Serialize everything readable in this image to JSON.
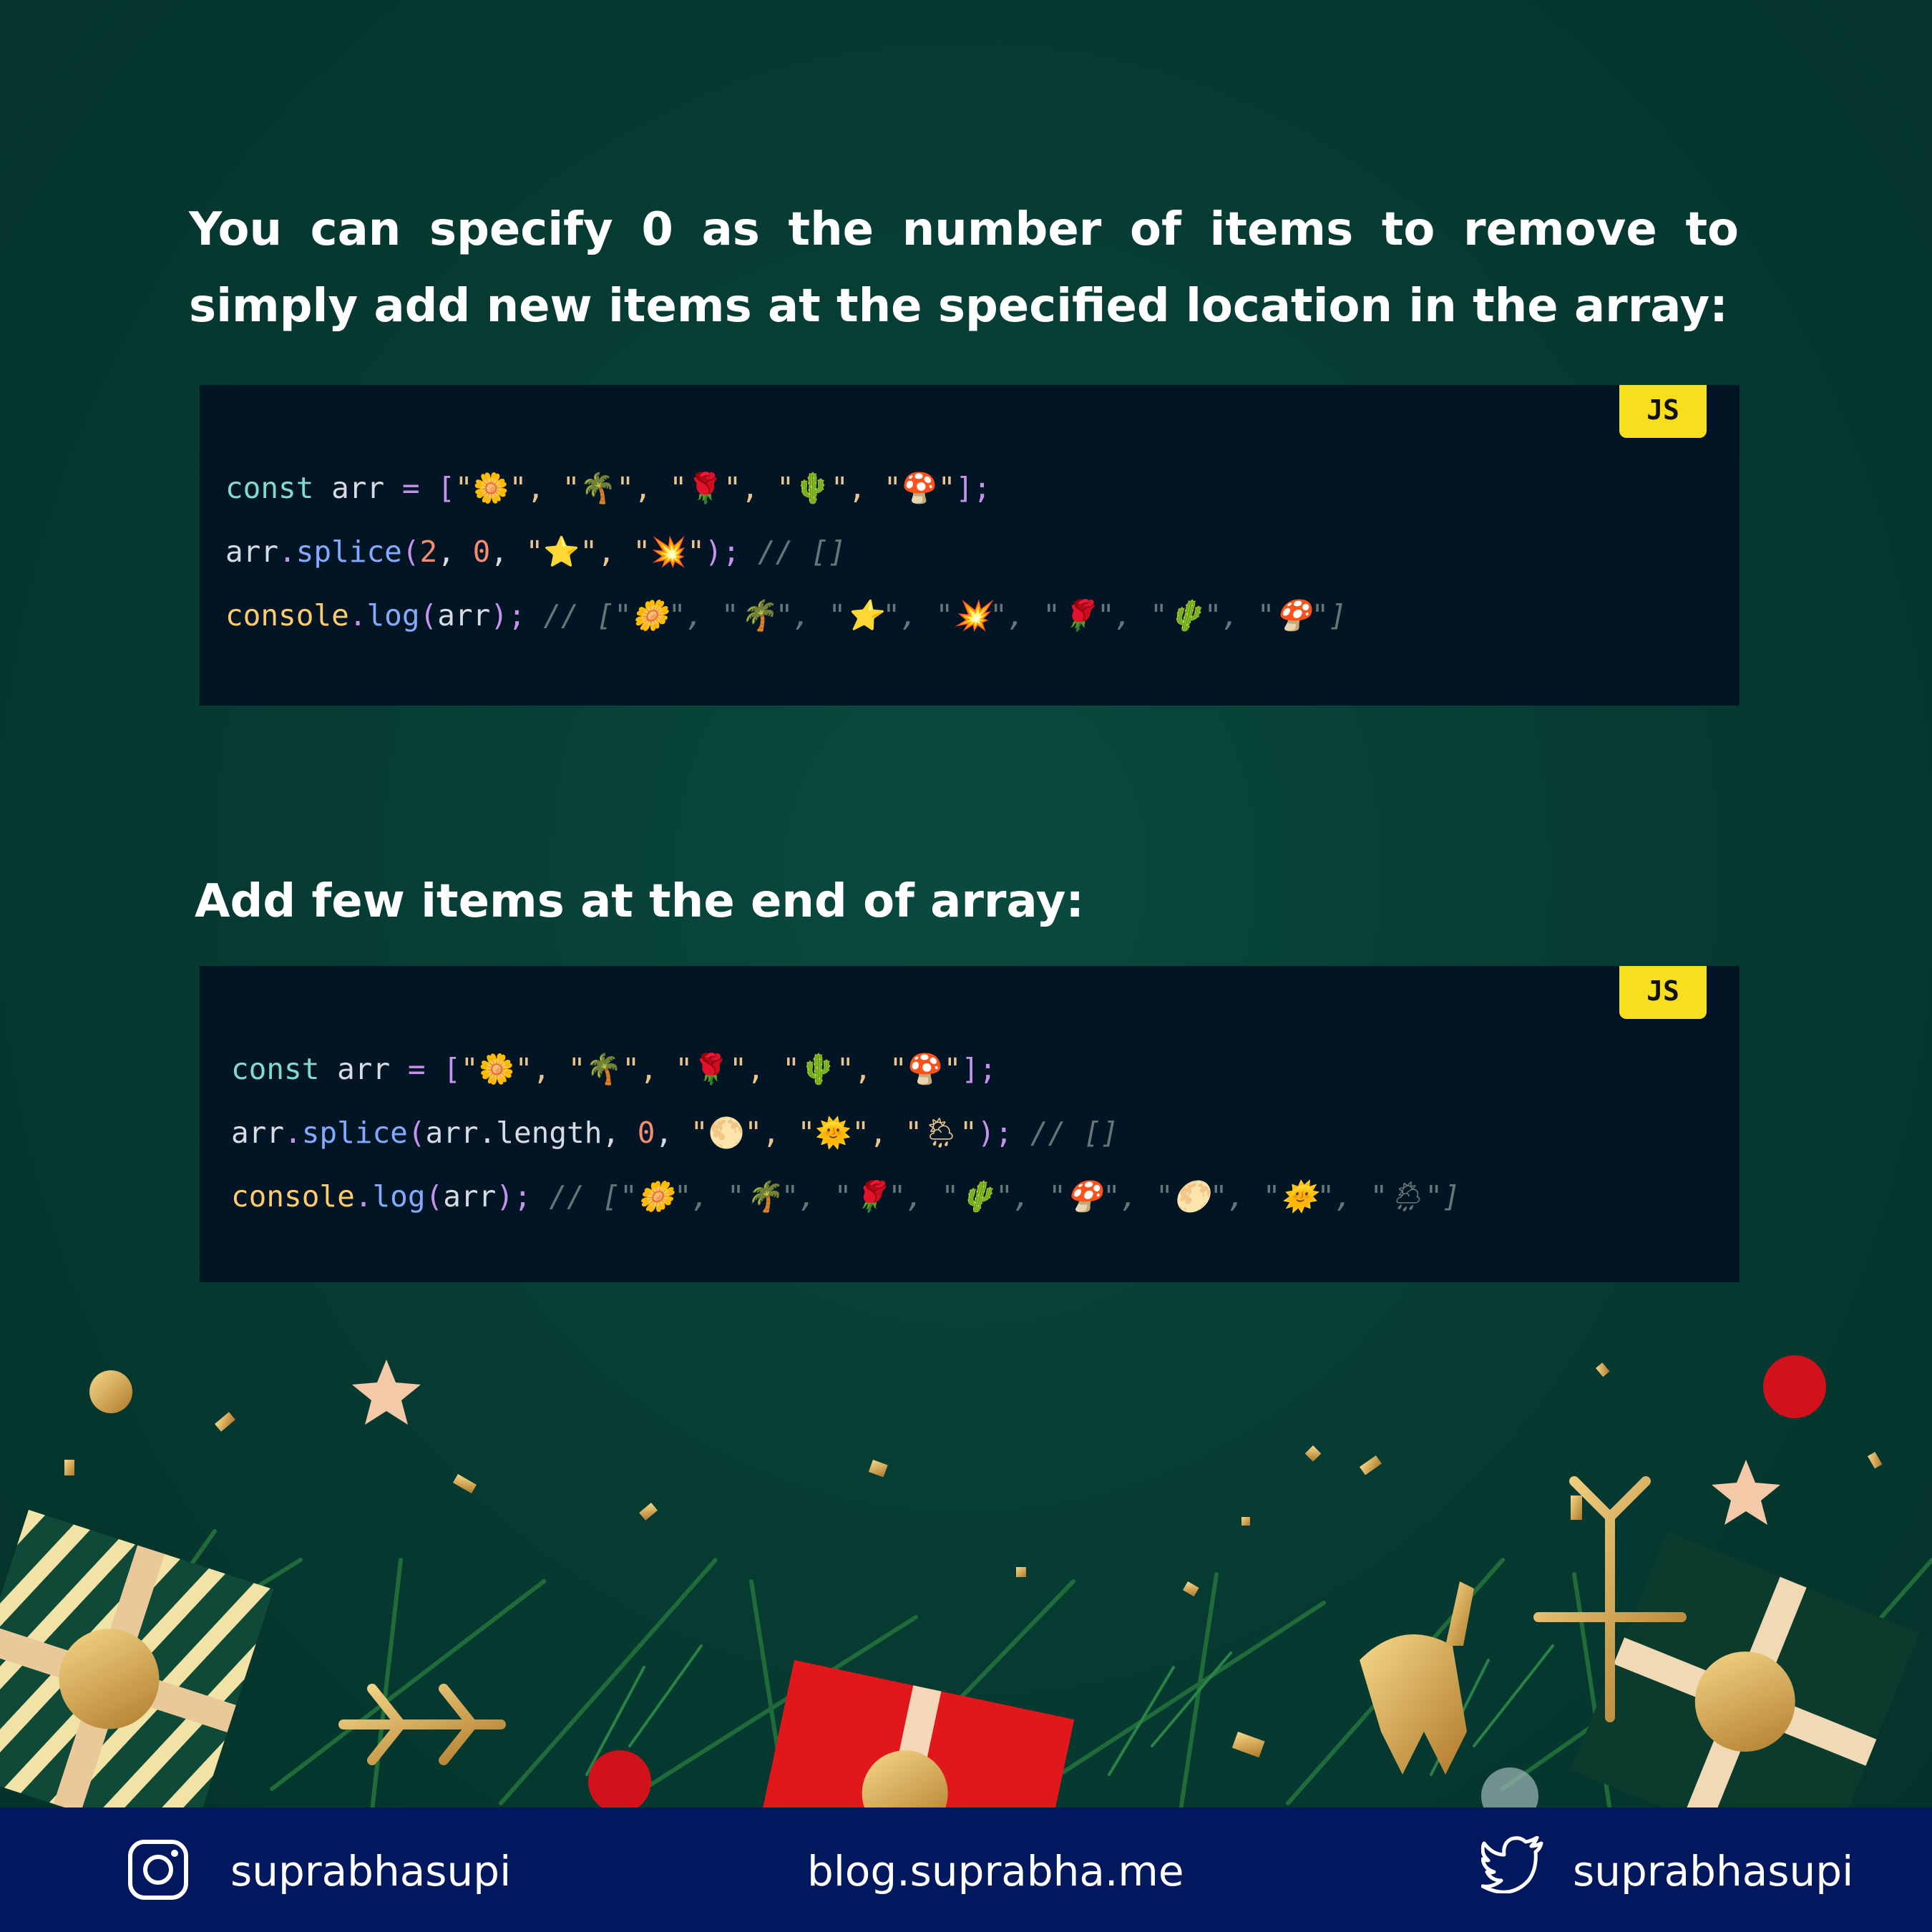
{
  "section1": {
    "heading": "You can specify 0 as the number of items to remove to simply add new items at the specified location in the array:",
    "badge": "JS",
    "line1": {
      "kw": "const",
      "name": " arr ",
      "eq": "=",
      "sp": " ",
      "open": "[",
      "items": "\"🌼\", \"🌴\", \"🌹\", \"🌵\", \"🍄\"",
      "close": "];"
    },
    "line2": {
      "obj": "arr",
      "dot": ".",
      "fn": "splice",
      "open": "(",
      "n1": "2",
      "sep1": ", ",
      "n2": "0",
      "sep2": ", ",
      "items": "\"⭐\", \"💥\"",
      "close": ");",
      "comment": " // []"
    },
    "line3": {
      "obj": "console",
      "dot": ".",
      "fn": "log",
      "open": "(",
      "arg": "arr",
      "close": ");",
      "comment": " // [\"🌼\", \"🌴\", \"⭐\", \"💥\", \"🌹\", \"🌵\", \"🍄\"]"
    }
  },
  "section2": {
    "heading": "Add few items at the end of array:",
    "badge": "JS",
    "line1": {
      "kw": "const",
      "name": " arr ",
      "eq": "=",
      "sp": " ",
      "open": "[",
      "items": "\"🌼\", \"🌴\", \"🌹\", \"🌵\", \"🍄\"",
      "close": "];"
    },
    "line2": {
      "obj": "arr",
      "dot": ".",
      "fn": "splice",
      "open": "(",
      "arg": "arr.length",
      "sep1": ", ",
      "n2": "0",
      "sep2": ", ",
      "items": "\"🌕\", \"🌞\", \"🌦\"",
      "close": ");",
      "comment": " // []"
    },
    "line3": {
      "obj": "console",
      "dot": ".",
      "fn": "log",
      "open": "(",
      "arg": "arr",
      "close": ");",
      "comment": " // [\"🌼\", \"🌴\", \"🌹\", \"🌵\", \"🍄\", \"🌕\", \"🌞\", \"🌦\"]"
    }
  },
  "footer": {
    "instagram_handle": "suprabhasupi",
    "blog": "blog.suprabha.me",
    "twitter_handle": "suprabhasupi"
  },
  "decoration_icons": [
    "gift-box-icon",
    "ornament-ball-icon",
    "star-icon",
    "snowflake-icon",
    "reindeer-icon",
    "pine-branch-icon",
    "confetti-icon"
  ],
  "colors": {
    "background": "#063c33",
    "code_panel": "#011524",
    "js_badge": "#f7df1e",
    "footer": "#01185e",
    "gift_red": "#e0181c",
    "gold": "#d9a441"
  }
}
